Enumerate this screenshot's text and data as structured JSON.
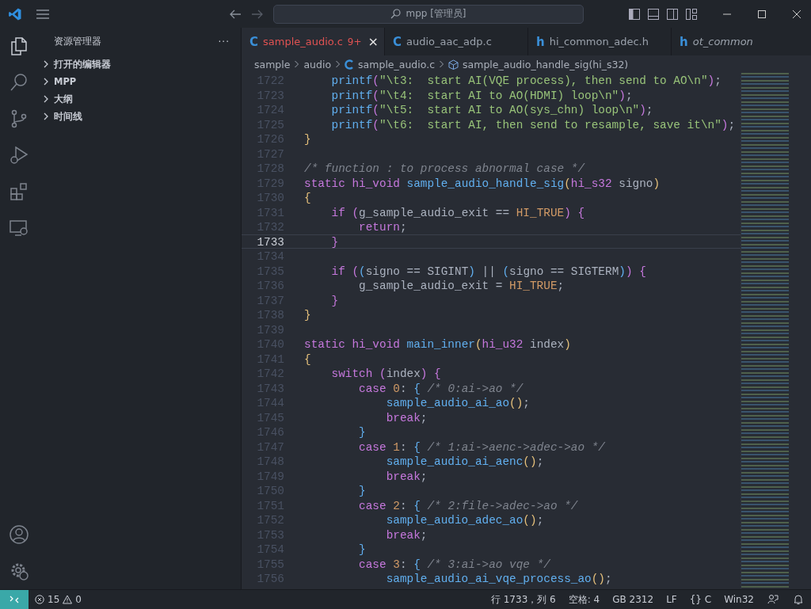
{
  "title_bar": {
    "search": "mpp [管理员]"
  },
  "sidebar": {
    "title": "资源管理器",
    "more": "···",
    "sections": [
      {
        "label": "打开的编辑器",
        "expanded": false
      },
      {
        "label": "MPP",
        "expanded": false
      },
      {
        "label": "大纲",
        "expanded": false
      },
      {
        "label": "时间线",
        "expanded": false
      }
    ]
  },
  "tabs": [
    {
      "icon": "C",
      "label": "sample_audio.c",
      "badge": "9+",
      "close": "×",
      "selected": true,
      "italic": false
    },
    {
      "icon": "C",
      "label": "audio_aac_adp.c",
      "selected": false,
      "italic": false
    },
    {
      "icon": "h",
      "label": "hi_common_adec.h",
      "selected": false,
      "italic": false
    },
    {
      "icon": "h",
      "label": "ot_common",
      "selected": false,
      "italic": true
    }
  ],
  "breadcrumb": [
    "sample",
    "audio",
    "sample_audio.c",
    "sample_audio_handle_sig(hi_s32)"
  ],
  "code": [
    {
      "n": "1722",
      "selected": false,
      "t": [
        {
          "kind": "f",
          "text": "    printf"
        },
        {
          "kind": "q",
          "text": "("
        },
        {
          "kind": "s",
          "text": "\"\\t3:  start AI(VQE process), then send to AO\\n\""
        },
        {
          "kind": "q",
          "text": ")"
        },
        {
          "kind": "p",
          "text": ";"
        }
      ]
    },
    {
      "n": "1723",
      "selected": false,
      "t": [
        {
          "kind": "f",
          "text": "    printf"
        },
        {
          "kind": "q",
          "text": "("
        },
        {
          "kind": "s",
          "text": "\"\\t4:  start AI to AO(HDMI) loop\\n\""
        },
        {
          "kind": "q",
          "text": ")"
        },
        {
          "kind": "p",
          "text": ";"
        }
      ]
    },
    {
      "n": "1724",
      "selected": false,
      "t": [
        {
          "kind": "f",
          "text": "    printf"
        },
        {
          "kind": "q",
          "text": "("
        },
        {
          "kind": "s",
          "text": "\"\\t5:  start AI to AO(sys_chn) loop\\n\""
        },
        {
          "kind": "q",
          "text": ")"
        },
        {
          "kind": "p",
          "text": ";"
        }
      ]
    },
    {
      "n": "1725",
      "selected": false,
      "t": [
        {
          "kind": "f",
          "text": "    printf"
        },
        {
          "kind": "q",
          "text": "("
        },
        {
          "kind": "s",
          "text": "\"\\t6:  start AI, then send to resample, save it\\n\""
        },
        {
          "kind": "q",
          "text": ")"
        },
        {
          "kind": "p",
          "text": ";"
        }
      ]
    },
    {
      "n": "1726",
      "selected": false,
      "t": [
        {
          "kind": "b",
          "text": "}"
        }
      ]
    },
    {
      "n": "1727",
      "selected": false
    },
    {
      "n": "1728",
      "selected": false,
      "t": [
        {
          "kind": "c",
          "text": "/* function : to process abnormal case */"
        }
      ]
    },
    {
      "n": "1729",
      "selected": false,
      "t": [
        {
          "kind": "k",
          "text": "static hi_void "
        },
        {
          "kind": "f",
          "text": "sample_audio_handle_sig"
        },
        {
          "kind": "b",
          "text": "("
        },
        {
          "kind": "k",
          "text": "hi_s32"
        },
        {
          "kind": "p",
          "text": " signo"
        },
        {
          "kind": "b",
          "text": ")"
        }
      ]
    },
    {
      "n": "1730",
      "selected": false,
      "t": [
        {
          "kind": "b",
          "text": "{"
        }
      ]
    },
    {
      "n": "1731",
      "selected": false,
      "t": [
        {
          "kind": "k",
          "text": "    if "
        },
        {
          "kind": "q",
          "text": "("
        },
        {
          "kind": "p",
          "text": "g_sample_audio_exit == "
        },
        {
          "kind": "n",
          "text": "HI_TRUE"
        },
        {
          "kind": "q",
          "text": ") {"
        }
      ]
    },
    {
      "n": "1732",
      "selected": false,
      "t": [
        {
          "kind": "k",
          "text": "        return"
        },
        {
          "kind": "p",
          "text": ";"
        }
      ]
    },
    {
      "n": "1733",
      "selected": true,
      "t": [
        {
          "kind": "q",
          "text": "    }"
        }
      ]
    },
    {
      "n": "1734",
      "selected": false
    },
    {
      "n": "1735",
      "selected": false,
      "t": [
        {
          "kind": "k",
          "text": "    if "
        },
        {
          "kind": "q",
          "text": "("
        },
        {
          "kind": "r",
          "text": "("
        },
        {
          "kind": "p",
          "text": "signo == SIGINT"
        },
        {
          "kind": "r",
          "text": ")"
        },
        {
          "kind": "p",
          "text": " || "
        },
        {
          "kind": "r",
          "text": "("
        },
        {
          "kind": "p",
          "text": "signo == SIGTERM"
        },
        {
          "kind": "r",
          "text": ")"
        },
        {
          "kind": "q",
          "text": ") {"
        }
      ]
    },
    {
      "n": "1736",
      "selected": false,
      "t": [
        {
          "kind": "p",
          "text": "        g_sample_audio_exit = "
        },
        {
          "kind": "n",
          "text": "HI_TRUE"
        },
        {
          "kind": "p",
          "text": ";"
        }
      ]
    },
    {
      "n": "1737",
      "selected": false,
      "t": [
        {
          "kind": "q",
          "text": "    }"
        }
      ]
    },
    {
      "n": "1738",
      "selected": false,
      "t": [
        {
          "kind": "b",
          "text": "}"
        }
      ]
    },
    {
      "n": "1739",
      "selected": false
    },
    {
      "n": "1740",
      "selected": false,
      "t": [
        {
          "kind": "k",
          "text": "static hi_void "
        },
        {
          "kind": "f",
          "text": "main_inner"
        },
        {
          "kind": "b",
          "text": "("
        },
        {
          "kind": "k",
          "text": "hi_u32"
        },
        {
          "kind": "p",
          "text": " index"
        },
        {
          "kind": "b",
          "text": ")"
        }
      ]
    },
    {
      "n": "1741",
      "selected": false,
      "t": [
        {
          "kind": "b",
          "text": "{"
        }
      ]
    },
    {
      "n": "1742",
      "selected": false,
      "t": [
        {
          "kind": "k",
          "text": "    switch "
        },
        {
          "kind": "q",
          "text": "("
        },
        {
          "kind": "p",
          "text": "index"
        },
        {
          "kind": "q",
          "text": ") {"
        }
      ]
    },
    {
      "n": "1743",
      "selected": false,
      "t": [
        {
          "kind": "k",
          "text": "        case "
        },
        {
          "kind": "n",
          "text": "0"
        },
        {
          "kind": "p",
          "text": ": "
        },
        {
          "kind": "r",
          "text": "{ "
        },
        {
          "kind": "c",
          "text": "/* 0:ai->ao */"
        }
      ]
    },
    {
      "n": "1744",
      "selected": false,
      "t": [
        {
          "kind": "f",
          "text": "            sample_audio_ai_ao"
        },
        {
          "kind": "b",
          "text": "()"
        },
        {
          "kind": "p",
          "text": ";"
        }
      ]
    },
    {
      "n": "1745",
      "selected": false,
      "t": [
        {
          "kind": "k",
          "text": "            break"
        },
        {
          "kind": "p",
          "text": ";"
        }
      ]
    },
    {
      "n": "1746",
      "selected": false,
      "t": [
        {
          "kind": "r",
          "text": "        }"
        }
      ]
    },
    {
      "n": "1747",
      "selected": false,
      "t": [
        {
          "kind": "k",
          "text": "        case "
        },
        {
          "kind": "n",
          "text": "1"
        },
        {
          "kind": "p",
          "text": ": "
        },
        {
          "kind": "r",
          "text": "{ "
        },
        {
          "kind": "c",
          "text": "/* 1:ai->aenc->adec->ao */"
        }
      ]
    },
    {
      "n": "1748",
      "selected": false,
      "t": [
        {
          "kind": "f",
          "text": "            sample_audio_ai_aenc"
        },
        {
          "kind": "b",
          "text": "()"
        },
        {
          "kind": "p",
          "text": ";"
        }
      ]
    },
    {
      "n": "1749",
      "selected": false,
      "t": [
        {
          "kind": "k",
          "text": "            break"
        },
        {
          "kind": "p",
          "text": ";"
        }
      ]
    },
    {
      "n": "1750",
      "selected": false,
      "t": [
        {
          "kind": "r",
          "text": "        }"
        }
      ]
    },
    {
      "n": "1751",
      "selected": false,
      "t": [
        {
          "kind": "k",
          "text": "        case "
        },
        {
          "kind": "n",
          "text": "2"
        },
        {
          "kind": "p",
          "text": ": "
        },
        {
          "kind": "r",
          "text": "{ "
        },
        {
          "kind": "c",
          "text": "/* 2:file->adec->ao */"
        }
      ]
    },
    {
      "n": "1752",
      "selected": false,
      "t": [
        {
          "kind": "f",
          "text": "            sample_audio_adec_ao"
        },
        {
          "kind": "b",
          "text": "()"
        },
        {
          "kind": "p",
          "text": ";"
        }
      ]
    },
    {
      "n": "1753",
      "selected": false,
      "t": [
        {
          "kind": "k",
          "text": "            break"
        },
        {
          "kind": "p",
          "text": ";"
        }
      ]
    },
    {
      "n": "1754",
      "selected": false,
      "t": [
        {
          "kind": "r",
          "text": "        }"
        }
      ]
    },
    {
      "n": "1755",
      "selected": false,
      "t": [
        {
          "kind": "k",
          "text": "        case "
        },
        {
          "kind": "n",
          "text": "3"
        },
        {
          "kind": "p",
          "text": ": "
        },
        {
          "kind": "r",
          "text": "{ "
        },
        {
          "kind": "c",
          "text": "/* 3:ai->ao vqe */"
        }
      ]
    },
    {
      "n": "1756",
      "selected": false,
      "t": [
        {
          "kind": "f",
          "text": "            sample_audio_ai_vqe_process_ao"
        },
        {
          "kind": "b",
          "text": "()"
        },
        {
          "kind": "p",
          "text": ";"
        }
      ]
    }
  ],
  "status_bar": {
    "errors": "15",
    "warnings": "0",
    "position": "行 1733，列 6",
    "indent": "空格: 4",
    "encoding": "GB 2312",
    "eol": "LF",
    "language": "{} C",
    "platform": "Win32"
  }
}
